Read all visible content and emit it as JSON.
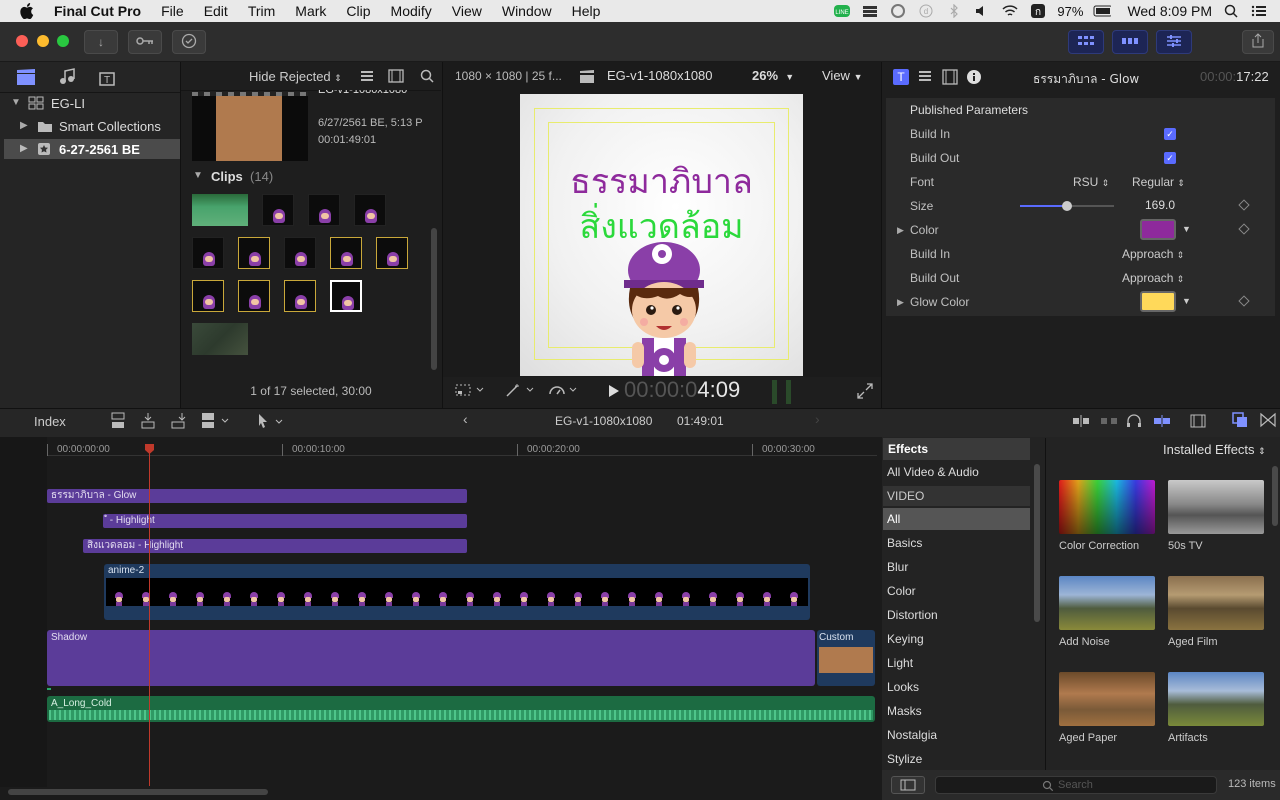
{
  "menubar": {
    "app": "Final Cut Pro",
    "items": [
      "File",
      "Edit",
      "Trim",
      "Mark",
      "Clip",
      "Modify",
      "View",
      "Window",
      "Help"
    ],
    "status": {
      "battery": "97%",
      "clock": "Wed 8:09 PM"
    }
  },
  "browser": {
    "filter_label": "Hide Rejected",
    "library": "EG-LI",
    "smart_collections": "Smart Collections",
    "event": "6-27-2561 BE",
    "top_clip_title": "EG-v1-1080x1080",
    "top_clip_date": "6/27/2561 BE, 5:13 P",
    "top_clip_duration": "00:01:49:01",
    "clips_label": "Clips",
    "clips_count": "(14)",
    "status": "1 of 17 selected, 30:00"
  },
  "viewer": {
    "format": "1080 × 1080 | 25 f...",
    "project": "EG-v1-1080x1080",
    "zoom": "26%",
    "view_menu": "View",
    "title_line1": "ธรรมาภิบาล",
    "title_line2": "สิ่งแวดล้อม",
    "timecode_dim": "00:00:0",
    "timecode_bright": "4:09",
    "badge_text": "ETDA"
  },
  "inspector": {
    "title": "ธรรมาภิบาล - Glow",
    "time_dim": "00:00:",
    "time_bright": "17:22",
    "section": "Published Parameters",
    "build_in_label": "Build In",
    "build_out_label": "Build Out",
    "font_label": "Font",
    "font_family": "RSU",
    "font_style": "Regular",
    "size_label": "Size",
    "size_value": "169.0",
    "size_slider": 0.5,
    "color_label": "Color",
    "color_value": "#8e2a9c",
    "build_in2_label": "Build In",
    "build_in2_value": "Approach",
    "build_out2_label": "Build Out",
    "build_out2_value": "Approach",
    "glow_label": "Glow Color",
    "glow_value": "#ffd95a"
  },
  "timeline_bar": {
    "index": "Index",
    "project": "EG-v1-1080x1080",
    "duration": "01:49:01"
  },
  "timeline": {
    "ruler": [
      "00:00:00:00",
      "00:00:10:00",
      "00:00:20:00",
      "00:00:30:00"
    ],
    "clips": {
      "glow": "ธรรมาภิบาล - Glow",
      "highlight1": "ํ - Highlight",
      "highlight2": "สิ่งแวดลอม - Highlight",
      "anime": "anime-2",
      "shadow": "Shadow",
      "custom": "Custom",
      "audio": "A_Long_Cold"
    }
  },
  "effects": {
    "header": "Effects",
    "installed": "Installed Effects",
    "categories": [
      "All Video & Audio",
      "VIDEO",
      "All",
      "Basics",
      "Blur",
      "Color",
      "Distortion",
      "Keying",
      "Light",
      "Looks",
      "Masks",
      "Nostalgia",
      "Stylize"
    ],
    "items": [
      "Color Correction",
      "50s TV",
      "Add Noise",
      "Aged Film",
      "Aged Paper",
      "Artifacts"
    ],
    "search_placeholder": "Search",
    "count": "123 items"
  }
}
